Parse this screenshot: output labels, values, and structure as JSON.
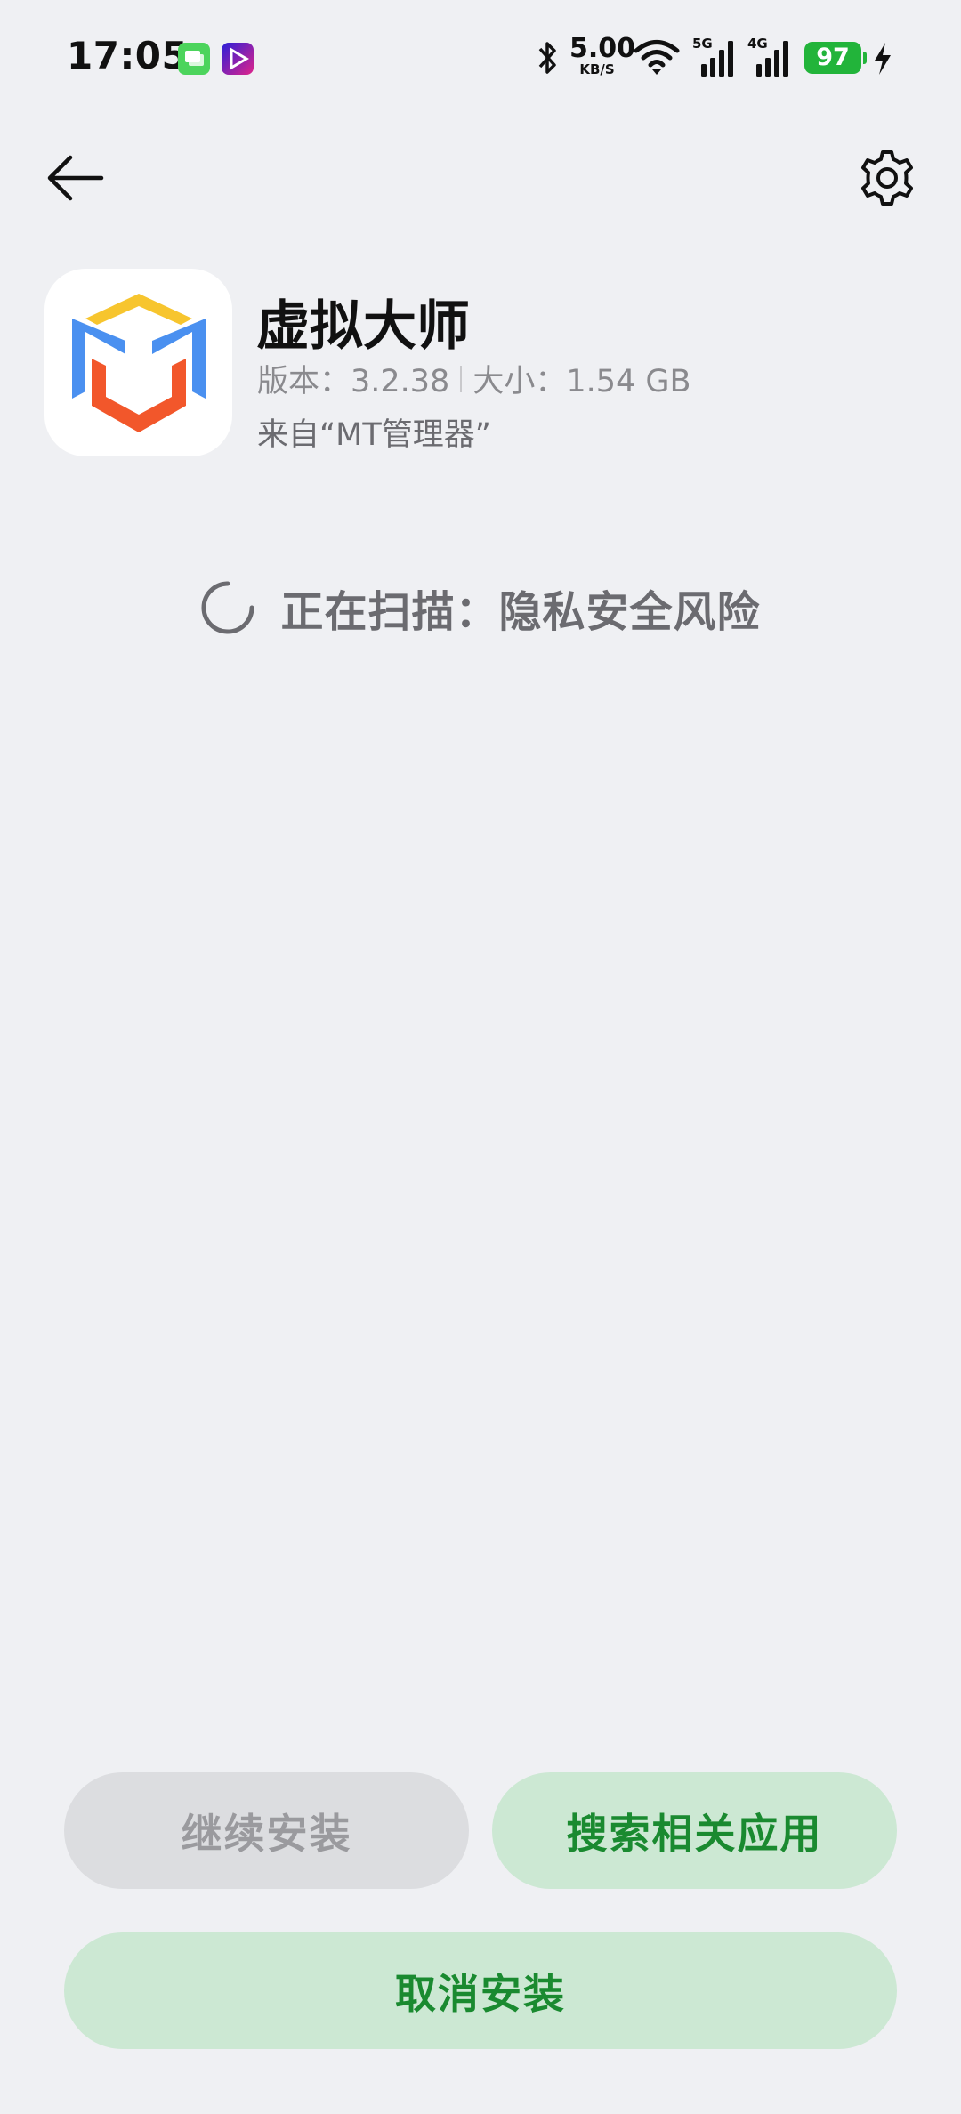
{
  "status_bar": {
    "time": "17:05",
    "net_speed_value": "5.00",
    "net_speed_unit": "KB/S",
    "signal1_tag": "5G",
    "signal2_tag": "4G",
    "battery": "97",
    "icons": [
      "messages-notification-icon",
      "video-notification-icon",
      "bluetooth-icon",
      "wifi-icon",
      "cellular-signal-icon",
      "charging-bolt-icon"
    ]
  },
  "nav": {
    "back_icon": "back-arrow-icon",
    "settings_icon": "gear-icon"
  },
  "app": {
    "name": "虚拟大师",
    "version": "版本：3.2.38",
    "size": "大小：1.54 GB",
    "source": "来自“MT管理器”",
    "icon_colors": {
      "top": "#f7c52e",
      "sides": "#4a90f0",
      "bottom": "#f2572b"
    }
  },
  "scan": {
    "text": "正在扫描：隐私安全风险"
  },
  "buttons": {
    "continue_install": "继续安装",
    "search_related": "搜索相关应用",
    "cancel_install": "取消安装"
  },
  "colors": {
    "background": "#eff0f3",
    "accent_green": "#1a8a30",
    "green_button_bg": "#cce8d3",
    "disabled_button_bg": "#dcdde0",
    "battery_green": "#22b43a"
  }
}
